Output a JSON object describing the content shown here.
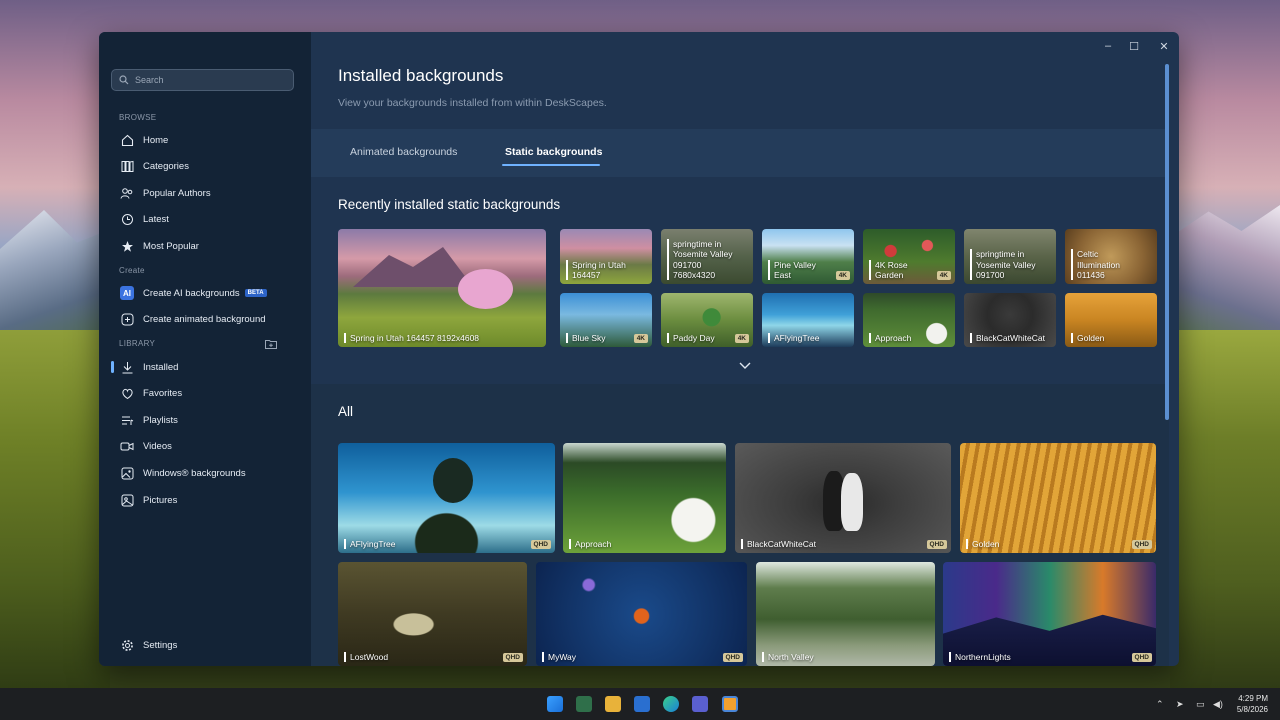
{
  "sidebar": {
    "search_placeholder": "Search",
    "browse_label": "BROWSE",
    "browse_items": [
      {
        "label": "Home",
        "icon": "home-icon"
      },
      {
        "label": "Categories",
        "icon": "categories-icon"
      },
      {
        "label": "Popular Authors",
        "icon": "authors-icon"
      },
      {
        "label": "Latest",
        "icon": "latest-icon"
      },
      {
        "label": "Most Popular",
        "icon": "star-icon"
      }
    ],
    "create_label": "Create",
    "create_items": [
      {
        "label": "Create AI backgrounds",
        "badge": "BETA",
        "icon_text": "AI"
      },
      {
        "label": "Create animated background",
        "icon": "plus-box-icon"
      }
    ],
    "library_label": "LIBRARY",
    "library_items": [
      {
        "label": "Installed",
        "icon": "download-icon",
        "active": true
      },
      {
        "label": "Favorites",
        "icon": "heart-icon"
      },
      {
        "label": "Playlists",
        "icon": "playlist-icon"
      },
      {
        "label": "Videos",
        "icon": "video-icon"
      },
      {
        "label": "Windows® backgrounds",
        "icon": "image-icon"
      },
      {
        "label": "Pictures",
        "icon": "picture-icon"
      }
    ],
    "settings_label": "Settings"
  },
  "header": {
    "title": "Installed backgrounds",
    "subtitle": "View your backgrounds installed from within DeskScapes."
  },
  "tabs": [
    {
      "label": "Animated backgrounds",
      "active": false
    },
    {
      "label": "Static backgrounds",
      "active": true
    }
  ],
  "recent": {
    "title": "Recently installed static backgrounds",
    "featured": {
      "label": "Spring in Utah 164457 8192x4608"
    },
    "items": [
      {
        "label": "Spring in Utah\n164457",
        "badge": ""
      },
      {
        "label": "springtime in\nYosemite Valley\n091700\n7680x4320",
        "badge": ""
      },
      {
        "label": "Pine Valley\nEast",
        "badge": "4K"
      },
      {
        "label": "4K Rose\nGarden",
        "badge": "4K"
      },
      {
        "label": "springtime in\nYosemite Valley\n091700",
        "badge": ""
      },
      {
        "label": "Celtic\nIllumination\n011436",
        "badge": ""
      },
      {
        "label": "Blue Sky",
        "badge": "4K"
      },
      {
        "label": "Paddy Day",
        "badge": "4K"
      },
      {
        "label": "AFlyingTree",
        "badge": ""
      },
      {
        "label": "Approach",
        "badge": ""
      },
      {
        "label": "BlackCatWhiteCat",
        "badge": ""
      },
      {
        "label": "Golden",
        "badge": ""
      }
    ]
  },
  "all": {
    "title": "All",
    "items": [
      {
        "label": "AFlyingTree",
        "badge": "QHD"
      },
      {
        "label": "Approach",
        "badge": ""
      },
      {
        "label": "BlackCatWhiteCat",
        "badge": "QHD"
      },
      {
        "label": "Golden",
        "badge": "QHD"
      },
      {
        "label": "LostWood",
        "badge": "QHD"
      },
      {
        "label": "MyWay",
        "badge": "QHD"
      },
      {
        "label": "North Valley",
        "badge": ""
      },
      {
        "label": "NorthernLights",
        "badge": "QHD"
      }
    ]
  },
  "taskbar": {
    "time": "4:29 PM",
    "date": "5/8/2026"
  },
  "colors": {
    "accent": "#6fb2ff",
    "sidebar_bg": "#132336",
    "main_bg": "#1f3450",
    "badge_bg": "#d6c89a"
  }
}
